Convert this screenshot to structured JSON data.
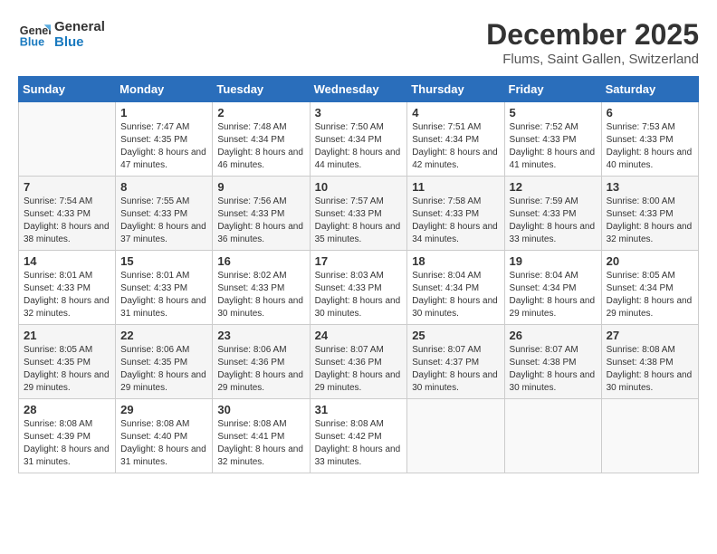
{
  "logo": {
    "line1": "General",
    "line2": "Blue"
  },
  "title": "December 2025",
  "location": "Flums, Saint Gallen, Switzerland",
  "days_of_week": [
    "Sunday",
    "Monday",
    "Tuesday",
    "Wednesday",
    "Thursday",
    "Friday",
    "Saturday"
  ],
  "weeks": [
    [
      {
        "day": "",
        "sunrise": "",
        "sunset": "",
        "daylight": ""
      },
      {
        "day": "1",
        "sunrise": "Sunrise: 7:47 AM",
        "sunset": "Sunset: 4:35 PM",
        "daylight": "Daylight: 8 hours and 47 minutes."
      },
      {
        "day": "2",
        "sunrise": "Sunrise: 7:48 AM",
        "sunset": "Sunset: 4:34 PM",
        "daylight": "Daylight: 8 hours and 46 minutes."
      },
      {
        "day": "3",
        "sunrise": "Sunrise: 7:50 AM",
        "sunset": "Sunset: 4:34 PM",
        "daylight": "Daylight: 8 hours and 44 minutes."
      },
      {
        "day": "4",
        "sunrise": "Sunrise: 7:51 AM",
        "sunset": "Sunset: 4:34 PM",
        "daylight": "Daylight: 8 hours and 42 minutes."
      },
      {
        "day": "5",
        "sunrise": "Sunrise: 7:52 AM",
        "sunset": "Sunset: 4:33 PM",
        "daylight": "Daylight: 8 hours and 41 minutes."
      },
      {
        "day": "6",
        "sunrise": "Sunrise: 7:53 AM",
        "sunset": "Sunset: 4:33 PM",
        "daylight": "Daylight: 8 hours and 40 minutes."
      }
    ],
    [
      {
        "day": "7",
        "sunrise": "Sunrise: 7:54 AM",
        "sunset": "Sunset: 4:33 PM",
        "daylight": "Daylight: 8 hours and 38 minutes."
      },
      {
        "day": "8",
        "sunrise": "Sunrise: 7:55 AM",
        "sunset": "Sunset: 4:33 PM",
        "daylight": "Daylight: 8 hours and 37 minutes."
      },
      {
        "day": "9",
        "sunrise": "Sunrise: 7:56 AM",
        "sunset": "Sunset: 4:33 PM",
        "daylight": "Daylight: 8 hours and 36 minutes."
      },
      {
        "day": "10",
        "sunrise": "Sunrise: 7:57 AM",
        "sunset": "Sunset: 4:33 PM",
        "daylight": "Daylight: 8 hours and 35 minutes."
      },
      {
        "day": "11",
        "sunrise": "Sunrise: 7:58 AM",
        "sunset": "Sunset: 4:33 PM",
        "daylight": "Daylight: 8 hours and 34 minutes."
      },
      {
        "day": "12",
        "sunrise": "Sunrise: 7:59 AM",
        "sunset": "Sunset: 4:33 PM",
        "daylight": "Daylight: 8 hours and 33 minutes."
      },
      {
        "day": "13",
        "sunrise": "Sunrise: 8:00 AM",
        "sunset": "Sunset: 4:33 PM",
        "daylight": "Daylight: 8 hours and 32 minutes."
      }
    ],
    [
      {
        "day": "14",
        "sunrise": "Sunrise: 8:01 AM",
        "sunset": "Sunset: 4:33 PM",
        "daylight": "Daylight: 8 hours and 32 minutes."
      },
      {
        "day": "15",
        "sunrise": "Sunrise: 8:01 AM",
        "sunset": "Sunset: 4:33 PM",
        "daylight": "Daylight: 8 hours and 31 minutes."
      },
      {
        "day": "16",
        "sunrise": "Sunrise: 8:02 AM",
        "sunset": "Sunset: 4:33 PM",
        "daylight": "Daylight: 8 hours and 30 minutes."
      },
      {
        "day": "17",
        "sunrise": "Sunrise: 8:03 AM",
        "sunset": "Sunset: 4:33 PM",
        "daylight": "Daylight: 8 hours and 30 minutes."
      },
      {
        "day": "18",
        "sunrise": "Sunrise: 8:04 AM",
        "sunset": "Sunset: 4:34 PM",
        "daylight": "Daylight: 8 hours and 30 minutes."
      },
      {
        "day": "19",
        "sunrise": "Sunrise: 8:04 AM",
        "sunset": "Sunset: 4:34 PM",
        "daylight": "Daylight: 8 hours and 29 minutes."
      },
      {
        "day": "20",
        "sunrise": "Sunrise: 8:05 AM",
        "sunset": "Sunset: 4:34 PM",
        "daylight": "Daylight: 8 hours and 29 minutes."
      }
    ],
    [
      {
        "day": "21",
        "sunrise": "Sunrise: 8:05 AM",
        "sunset": "Sunset: 4:35 PM",
        "daylight": "Daylight: 8 hours and 29 minutes."
      },
      {
        "day": "22",
        "sunrise": "Sunrise: 8:06 AM",
        "sunset": "Sunset: 4:35 PM",
        "daylight": "Daylight: 8 hours and 29 minutes."
      },
      {
        "day": "23",
        "sunrise": "Sunrise: 8:06 AM",
        "sunset": "Sunset: 4:36 PM",
        "daylight": "Daylight: 8 hours and 29 minutes."
      },
      {
        "day": "24",
        "sunrise": "Sunrise: 8:07 AM",
        "sunset": "Sunset: 4:36 PM",
        "daylight": "Daylight: 8 hours and 29 minutes."
      },
      {
        "day": "25",
        "sunrise": "Sunrise: 8:07 AM",
        "sunset": "Sunset: 4:37 PM",
        "daylight": "Daylight: 8 hours and 30 minutes."
      },
      {
        "day": "26",
        "sunrise": "Sunrise: 8:07 AM",
        "sunset": "Sunset: 4:38 PM",
        "daylight": "Daylight: 8 hours and 30 minutes."
      },
      {
        "day": "27",
        "sunrise": "Sunrise: 8:08 AM",
        "sunset": "Sunset: 4:38 PM",
        "daylight": "Daylight: 8 hours and 30 minutes."
      }
    ],
    [
      {
        "day": "28",
        "sunrise": "Sunrise: 8:08 AM",
        "sunset": "Sunset: 4:39 PM",
        "daylight": "Daylight: 8 hours and 31 minutes."
      },
      {
        "day": "29",
        "sunrise": "Sunrise: 8:08 AM",
        "sunset": "Sunset: 4:40 PM",
        "daylight": "Daylight: 8 hours and 31 minutes."
      },
      {
        "day": "30",
        "sunrise": "Sunrise: 8:08 AM",
        "sunset": "Sunset: 4:41 PM",
        "daylight": "Daylight: 8 hours and 32 minutes."
      },
      {
        "day": "31",
        "sunrise": "Sunrise: 8:08 AM",
        "sunset": "Sunset: 4:42 PM",
        "daylight": "Daylight: 8 hours and 33 minutes."
      },
      {
        "day": "",
        "sunrise": "",
        "sunset": "",
        "daylight": ""
      },
      {
        "day": "",
        "sunrise": "",
        "sunset": "",
        "daylight": ""
      },
      {
        "day": "",
        "sunrise": "",
        "sunset": "",
        "daylight": ""
      }
    ]
  ]
}
